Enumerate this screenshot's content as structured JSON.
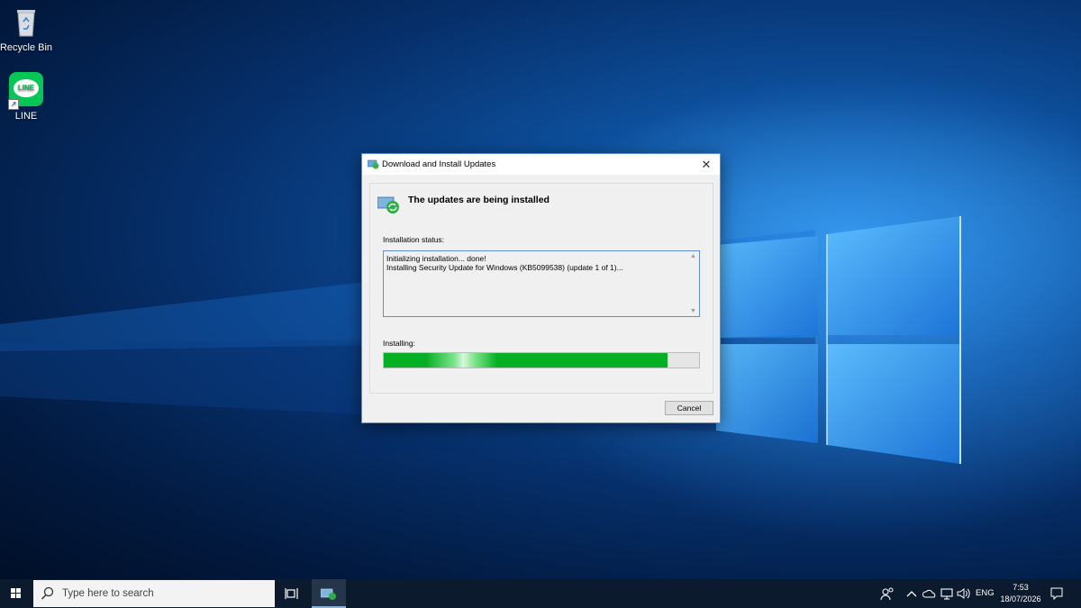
{
  "desktop": {
    "icons": [
      {
        "label": "Recycle Bin"
      },
      {
        "label": "LINE",
        "logo_text": "LINE",
        "logo_color": "#06c755"
      }
    ]
  },
  "dialog": {
    "title": "Download and Install Updates",
    "close_glyph": "✕",
    "heading": "The updates are being installed",
    "status_label": "Installation status:",
    "status_lines": [
      "Initializing installation... done!",
      "Installing Security Update for Windows (KB5099538) (update 1 of 1)..."
    ],
    "installing_label": "Installing:",
    "progress_percent": 90,
    "progress_color": "#06b025",
    "cancel_label": "Cancel"
  },
  "taskbar": {
    "search_placeholder": "Type here to search",
    "language": "ENG",
    "time": "7:53",
    "date": "18/07/2026",
    "tray_icons": [
      "people-icon",
      "chevron-up-icon",
      "network-icon",
      "volume-icon",
      "notification-icon"
    ]
  }
}
